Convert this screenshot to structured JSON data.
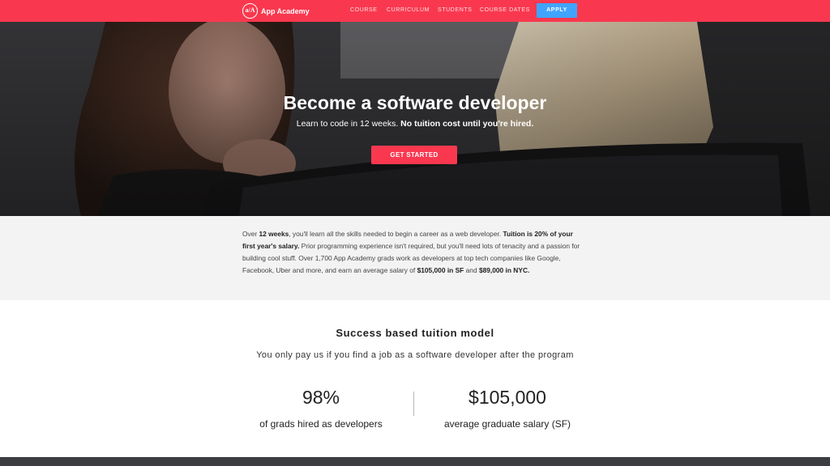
{
  "nav": {
    "logo_mark": "a/A",
    "logo_text": "App Academy",
    "links": [
      "COURSE",
      "CURRICULUM",
      "STUDENTS",
      "COURSE DATES"
    ],
    "apply": "APPLY"
  },
  "hero": {
    "title": "Become a software developer",
    "subtitle_plain": "Learn to code in 12 weeks.",
    "subtitle_bold": "No tuition cost until you're hired.",
    "cta": "GET STARTED"
  },
  "intro": {
    "t1": "Over ",
    "b1": "12 weeks",
    "t2": ", you'll learn all the skills needed to begin a career as a web developer. ",
    "b2": "Tuition is 20% of your first year's salary.",
    "t3": " Prior programming experience isn't required, but you'll need lots of tenacity and a passion for building cool stuff. Over 1,700 App Academy grads work as developers at top tech companies like Google, Facebook, Uber and more, and earn an average salary of ",
    "b3": "$105,000 in SF",
    "t4": " and ",
    "b4": "$89,000 in NYC.",
    "t5": ""
  },
  "success": {
    "title": "Success based tuition model",
    "subtitle": "You only pay us if you find a job as a software developer after the program",
    "stats": [
      {
        "value": "98%",
        "label": "of grads hired as developers"
      },
      {
        "value": "$105,000",
        "label": "average graduate salary (SF)"
      }
    ]
  },
  "colors": {
    "brand": "#f9384f",
    "apply": "#40a4ff",
    "intro_bg": "#f3f3f3",
    "footer": "#3b3d40"
  }
}
